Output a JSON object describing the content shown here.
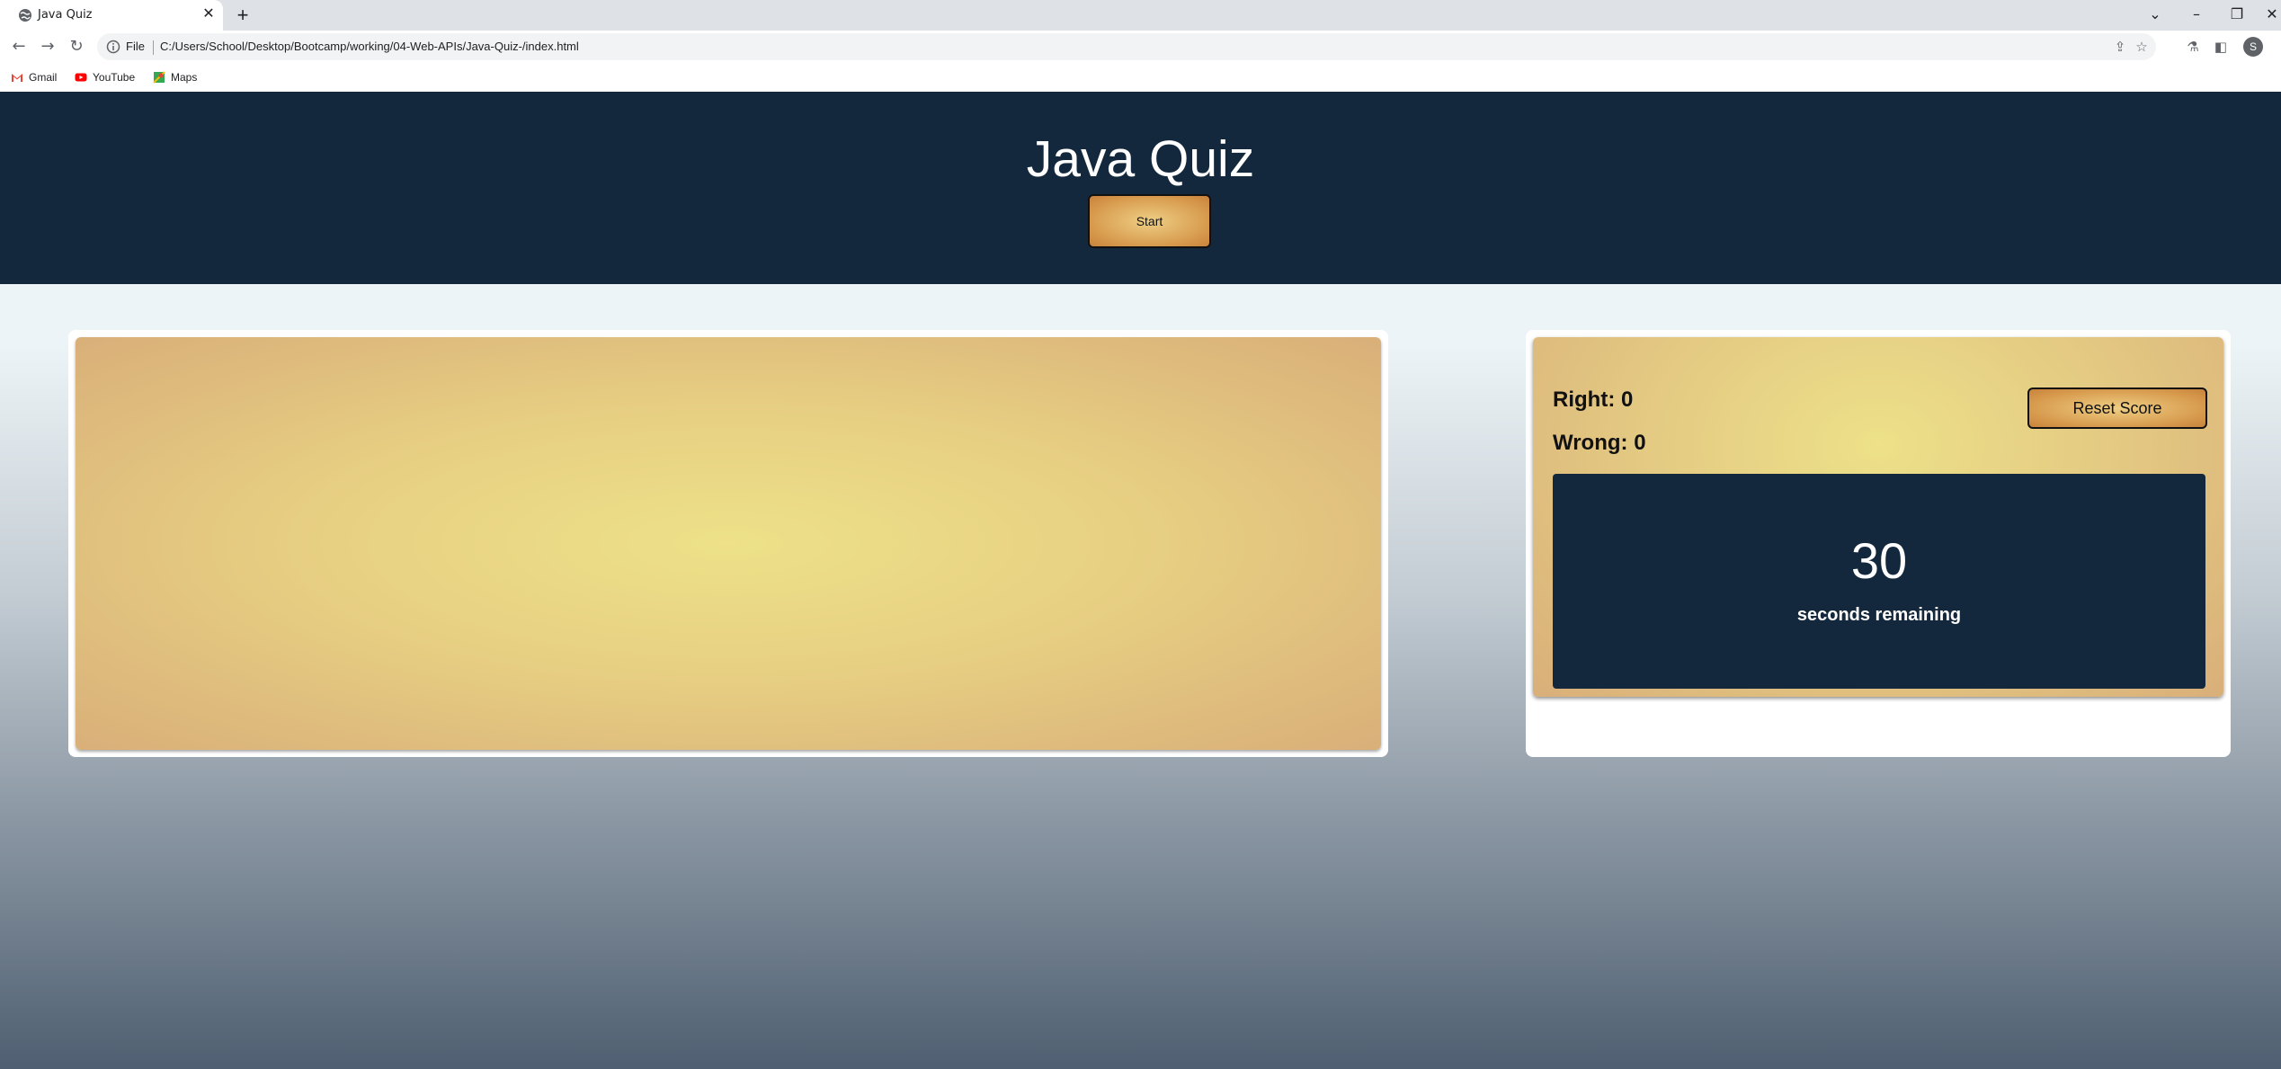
{
  "browser": {
    "tab_title": "Java Quiz",
    "scheme_label": "File",
    "url": "C:/Users/School/Desktop/Bootcamp/working/04-Web-APIs/Java-Quiz-/index.html",
    "profile_initial": "S",
    "bookmarks": [
      {
        "label": "Gmail",
        "icon": "gmail-icon"
      },
      {
        "label": "YouTube",
        "icon": "youtube-icon"
      },
      {
        "label": "Maps",
        "icon": "maps-icon"
      }
    ]
  },
  "header": {
    "title": "Java Quiz",
    "start_label": "Start"
  },
  "score": {
    "right_text": "Right: 0",
    "wrong_text": "Wrong: 0",
    "reset_label": "Reset Score"
  },
  "timer": {
    "value": "30",
    "caption": "seconds remaining"
  },
  "colors": {
    "header_bg": "#14283d",
    "button_gold": "#d79a4d",
    "card_gold": "#ede189"
  }
}
